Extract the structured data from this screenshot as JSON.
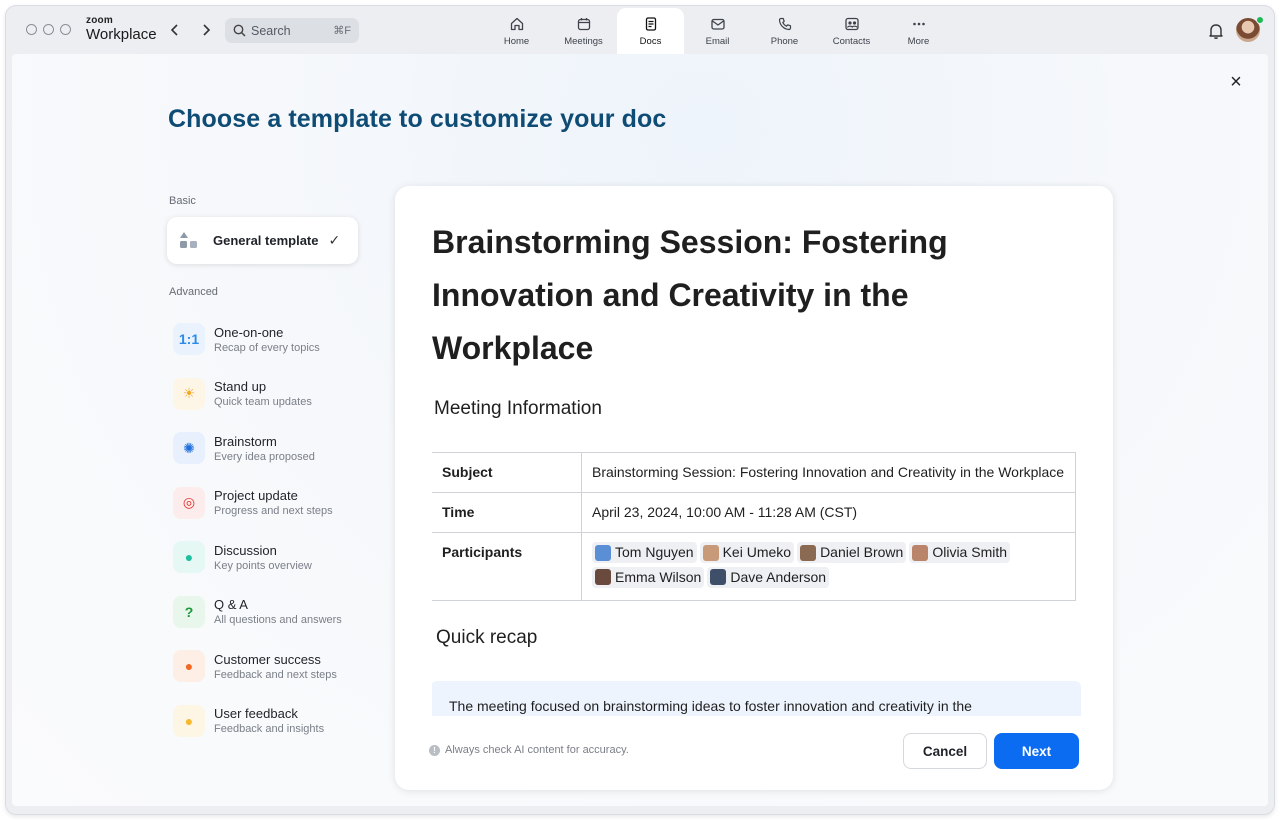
{
  "app": {
    "brand_small": "zoom",
    "brand_name": "Workplace"
  },
  "search": {
    "placeholder": "Search",
    "shortcut": "⌘F"
  },
  "tabs": [
    {
      "label": "Home",
      "icon": "home-icon"
    },
    {
      "label": "Meetings",
      "icon": "calendar-icon"
    },
    {
      "label": "Docs",
      "icon": "doc-icon",
      "active": true
    },
    {
      "label": "Email",
      "icon": "mail-icon"
    },
    {
      "label": "Phone",
      "icon": "phone-icon"
    },
    {
      "label": "Contacts",
      "icon": "contacts-icon"
    },
    {
      "label": "More",
      "icon": "more-icon"
    }
  ],
  "page": {
    "title": "Choose a template to customize your doc",
    "close": "×"
  },
  "sidebar": {
    "basic_label": "Basic",
    "general": {
      "label": "General template",
      "check": "✓"
    },
    "advanced_label": "Advanced",
    "items": [
      {
        "title": "One-on-one",
        "subtitle": "Recap of every topics",
        "icon": "one-on-one-icon",
        "glyph": "1:1",
        "color": "#2b8ce8",
        "bg": "#eaf3fd"
      },
      {
        "title": "Stand up",
        "subtitle": "Quick team updates",
        "icon": "sun-icon",
        "glyph": "☀",
        "color": "#f5a623",
        "bg": "#fdf5e6"
      },
      {
        "title": "Brainstorm",
        "subtitle": "Every idea proposed",
        "icon": "brain-icon",
        "glyph": "✺",
        "color": "#1e6fdc",
        "bg": "#e8f0fd"
      },
      {
        "title": "Project update",
        "subtitle": "Progress and next steps",
        "icon": "target-icon",
        "glyph": "◎",
        "color": "#e0322b",
        "bg": "#fdecec"
      },
      {
        "title": "Discussion",
        "subtitle": "Key points overview",
        "icon": "chat-bubble-icon",
        "glyph": "●",
        "color": "#1fbf9f",
        "bg": "#e6f8f4"
      },
      {
        "title": "Q & A",
        "subtitle": "All questions and answers",
        "icon": "question-icon",
        "glyph": "?",
        "color": "#1a9a3a",
        "bg": "#e8f6ec"
      },
      {
        "title": "Customer success",
        "subtitle": "Feedback and next steps",
        "icon": "ribbon-icon",
        "glyph": "●",
        "color": "#f06a26",
        "bg": "#fdeee6"
      },
      {
        "title": "User feedback",
        "subtitle": "Feedback and insights",
        "icon": "user-icon",
        "glyph": "●",
        "color": "#f5b82e",
        "bg": "#fdf6e4"
      }
    ]
  },
  "preview": {
    "doc_title": "Brainstorming Session: Fostering Innovation and Creativity in the Workplace",
    "meeting_info_heading": "Meeting Information",
    "table": {
      "subject_label": "Subject",
      "subject_value": "Brainstorming Session: Fostering Innovation and Creativity in the Workplace",
      "time_label": "Time",
      "time_value": "April 23, 2024, 10:00 AM - 11:28 AM (CST)",
      "participants_label": "Participants",
      "participants": [
        "Tom Nguyen",
        "Kei Umeko",
        "Daniel Brown",
        "Olivia Smith",
        "Emma Wilson",
        "Dave Anderson"
      ]
    },
    "recap_heading": "Quick recap",
    "recap_text": "The meeting focused on brainstorming ideas to foster innovation and creativity in the"
  },
  "footer": {
    "note": "Always check AI content for accuracy.",
    "cancel": "Cancel",
    "next": "Next"
  }
}
